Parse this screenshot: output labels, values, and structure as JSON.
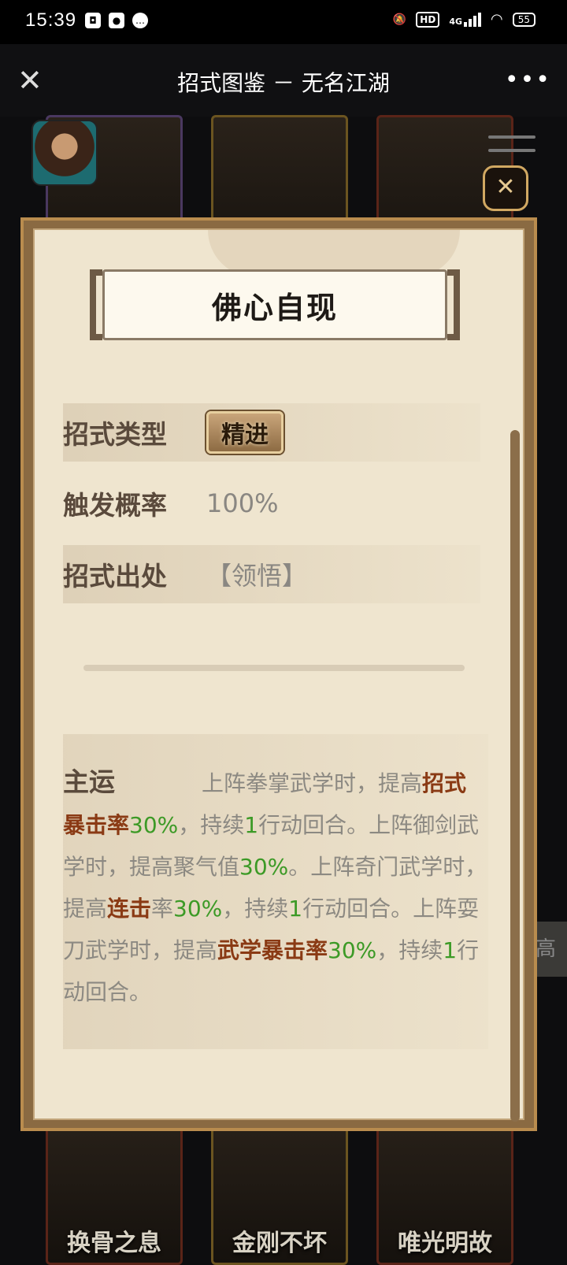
{
  "status_bar": {
    "time": "15:39",
    "network": "4G",
    "hd": "HD",
    "battery": "55"
  },
  "title_bar": {
    "close_glyph": "✕",
    "title": "招式图鉴 － 无名江湖",
    "more_glyph": "•••"
  },
  "background": {
    "top_cards": [
      "",
      "",
      ""
    ],
    "bottom_cards": [
      "换骨之息",
      "金刚不坏",
      "唯光明故"
    ],
    "side_strip_text": "高不"
  },
  "modal": {
    "close_glyph": "✕",
    "skill_name": "佛心自现",
    "rows": [
      {
        "label": "招式类型",
        "value": "精进"
      },
      {
        "label": "触发概率",
        "value": "100%"
      },
      {
        "label": "招式出处",
        "value": "【领悟】"
      }
    ],
    "description": {
      "lead": "主运",
      "segments": [
        {
          "text": "上阵拳掌武学时，提高",
          "style": "plain"
        },
        {
          "text": "招式暴击率",
          "style": "kw"
        },
        {
          "text": "30%",
          "style": "num"
        },
        {
          "text": "，持续",
          "style": "plain"
        },
        {
          "text": "1",
          "style": "num"
        },
        {
          "text": "行动回合。上阵御剑武学时，提高聚气值",
          "style": "plain"
        },
        {
          "text": "30%",
          "style": "num"
        },
        {
          "text": "。上阵奇门武学时，提高",
          "style": "plain"
        },
        {
          "text": "连击",
          "style": "kw"
        },
        {
          "text": "率",
          "style": "plain"
        },
        {
          "text": "30%",
          "style": "num"
        },
        {
          "text": "，持续",
          "style": "plain"
        },
        {
          "text": "1",
          "style": "num"
        },
        {
          "text": "行动回合。上阵耍刀武学时，提高",
          "style": "plain"
        },
        {
          "text": "武学暴击率",
          "style": "kw"
        },
        {
          "text": "30%",
          "style": "num"
        },
        {
          "text": "，持续",
          "style": "plain"
        },
        {
          "text": "1",
          "style": "num"
        },
        {
          "text": "行动回合。",
          "style": "plain"
        }
      ]
    }
  },
  "icons": {
    "status_left": [
      "gamepad-icon",
      "map-pin-icon",
      "chat-bubble-icon"
    ],
    "status_right": [
      "mute-bell-icon",
      "hd-icon",
      "signal-icon",
      "wifi-icon",
      "battery-icon"
    ]
  },
  "colors": {
    "keyword": "#8a3a14",
    "number": "#3c9a26",
    "parchment": "#efe5cf",
    "frame": "#8a6a42"
  }
}
